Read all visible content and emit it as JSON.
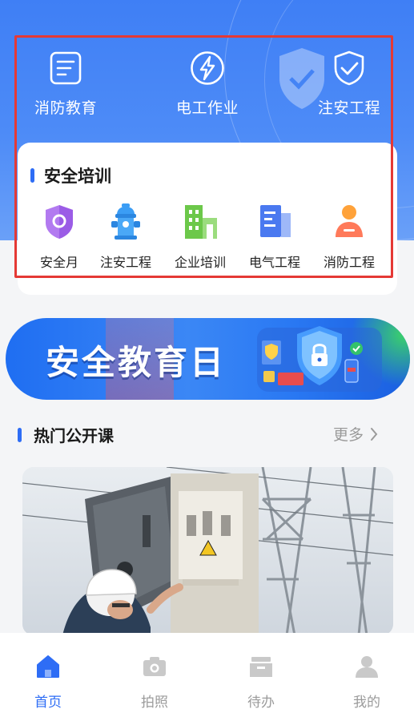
{
  "top_shortcuts": [
    {
      "label": "消防教育",
      "icon": "document-list-icon"
    },
    {
      "label": "电工作业",
      "icon": "lightning-icon"
    },
    {
      "label": "注安工程",
      "icon": "shield-check-icon"
    }
  ],
  "training": {
    "title": "安全培训",
    "items": [
      {
        "label": "安全月",
        "icon": "purple-shield-icon",
        "color": "#a25ce8"
      },
      {
        "label": "注安工程",
        "icon": "fire-hydrant-icon",
        "color": "#3b9df5"
      },
      {
        "label": "企业培训",
        "icon": "building-icon",
        "color": "#6cc84a"
      },
      {
        "label": "电气工程",
        "icon": "panel-icon",
        "color": "#4a79f0"
      },
      {
        "label": "消防工程",
        "icon": "person-icon",
        "color": "#ff8a5a"
      }
    ]
  },
  "banner": {
    "title": "安全教育日"
  },
  "hot_courses": {
    "title": "热门公开课",
    "more_label": "更多"
  },
  "tabbar": [
    {
      "label": "首页",
      "icon": "home-icon",
      "active": true
    },
    {
      "label": "拍照",
      "icon": "camera-icon",
      "active": false
    },
    {
      "label": "待办",
      "icon": "inbox-icon",
      "active": false
    },
    {
      "label": "我的",
      "icon": "user-icon",
      "active": false
    }
  ],
  "colors": {
    "accent": "#2e6df5",
    "hero": "#3f7ff5",
    "highlight": "#e53935"
  }
}
